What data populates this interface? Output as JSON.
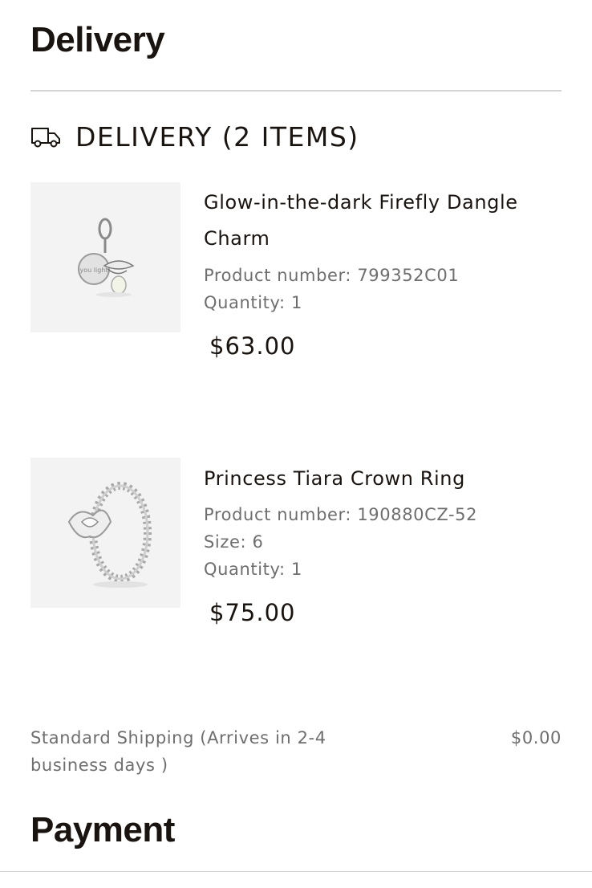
{
  "delivery_section": {
    "title": "Delivery"
  },
  "delivery_group": {
    "icon": "truck-icon",
    "label": "DELIVERY (2 ITEMS)"
  },
  "items": [
    {
      "image_icon": "firefly-charm-image",
      "name": "Glow-in-the-dark Firefly Dangle Charm",
      "product_number": "Product number: 799352C01",
      "quantity": "Quantity: 1",
      "price": "$63.00"
    },
    {
      "image_icon": "tiara-ring-image",
      "name": "Princess Tiara Crown Ring",
      "product_number": "Product number: 190880CZ-52",
      "size": "Size: 6",
      "quantity": "Quantity: 1",
      "price": "$75.00"
    }
  ],
  "shipping": {
    "label": "Standard Shipping (Arrives in 2-4 business days )",
    "price": "$0.00"
  },
  "payment_section": {
    "title": "Payment"
  },
  "colors": {
    "heading": "#1a1410",
    "muted": "#6e6e6e",
    "divider": "#d4d4d4",
    "thumb_bg": "#f3f3f3"
  }
}
